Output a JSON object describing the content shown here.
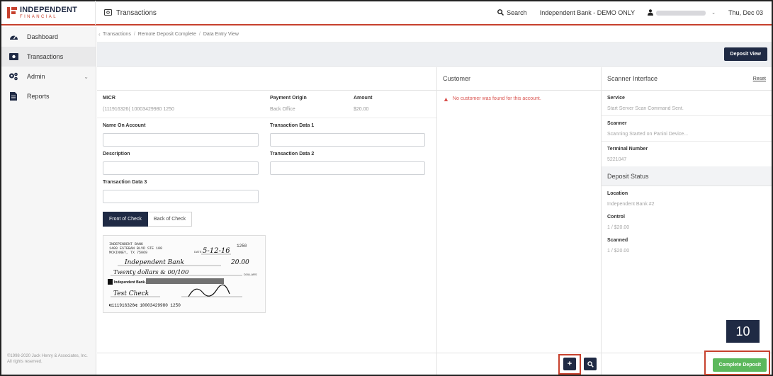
{
  "topbar": {
    "logo_main": "INDEPENDENT",
    "logo_sub": "FINANCIAL",
    "page_title": "Transactions",
    "search_label": "Search",
    "bank_label": "Independent Bank - DEMO ONLY",
    "date": "Thu, Dec 03"
  },
  "sidebar": {
    "items": [
      {
        "label": "Dashboard",
        "icon": "dashboard-icon"
      },
      {
        "label": "Transactions",
        "icon": "money-icon"
      },
      {
        "label": "Admin",
        "icon": "cogs-icon"
      },
      {
        "label": "Reports",
        "icon": "report-icon"
      }
    ],
    "copyright": "©1998-2020 Jack Henry & Associates, Inc. All rights reserved."
  },
  "breadcrumb": [
    "Transactions",
    "Remote Deposit Complete",
    "Data Entry View"
  ],
  "actions": {
    "deposit_view": "Deposit View"
  },
  "left": {
    "micr_label": "MICR",
    "micr_value": "(111916326( 10003429980 1250",
    "payment_origin_label": "Payment Origin",
    "payment_origin_value": "Back Office",
    "amount_label": "Amount",
    "amount_value": "$20.00",
    "name_on_account_label": "Name On Account",
    "transaction_data_1_label": "Transaction Data 1",
    "description_label": "Description",
    "transaction_data_2_label": "Transaction Data 2",
    "transaction_data_3_label": "Transaction Data 3",
    "tab_front": "Front of Check",
    "tab_back": "Back of Check"
  },
  "check": {
    "bank_line1": "INDEPENDENT BANK",
    "bank_line2": "1400 ESTEBAN BLVD STE 100",
    "bank_line3": "MCKINNEY, TX 75069",
    "check_number": "1250",
    "date_label": "DATE",
    "date_value": "5-12-16",
    "payee": "Independent Bank",
    "amount_numeric": "20.00",
    "amount_words": "Twenty dollars & 00/100",
    "dollars_label": "DOLLARS",
    "memo": "Test Check",
    "bank_name": "Independent Bank.",
    "micr_line": "⑆111916326⑆ 10003429980 1250"
  },
  "customer": {
    "title": "Customer",
    "warning": "No customer was found for this account."
  },
  "scanner": {
    "title": "Scanner Interface",
    "reset": "Reset",
    "service_label": "Service",
    "service_value": "Start Server Scan Command Sent.",
    "scanner_label": "Scanner",
    "scanner_value": "Scanning Started on Panini Device...",
    "terminal_label": "Terminal Number",
    "terminal_value": "5221047"
  },
  "deposit_status": {
    "title": "Deposit Status",
    "location_label": "Location",
    "location_value": "Independent Bank #2",
    "control_label": "Control",
    "control_value": "1 / $20.00",
    "scanned_label": "Scanned",
    "scanned_value": "1 / $20.00"
  },
  "footer": {
    "add_symbol": "+",
    "complete_deposit": "Complete Deposit"
  },
  "step_badge": "10",
  "colors": {
    "brand_navy": "#1f2a44",
    "brand_red": "#c7412d",
    "success_green": "#5cb85c",
    "warning_red": "#d9534f"
  }
}
